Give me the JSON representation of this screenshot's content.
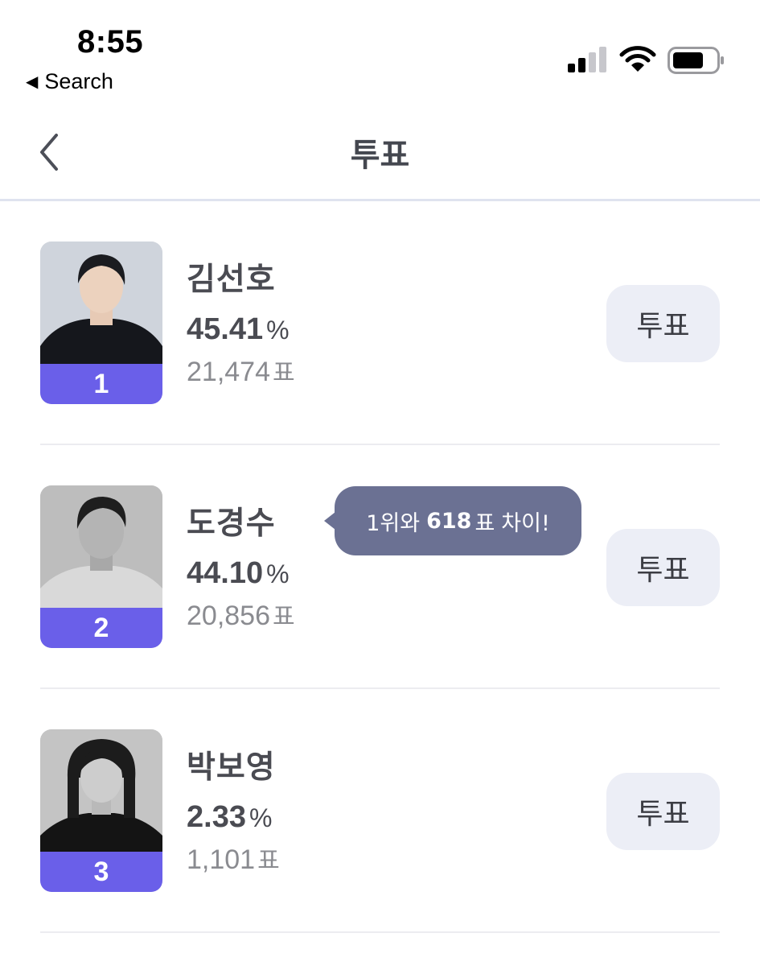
{
  "status_bar": {
    "time": "8:55",
    "back_label": "Search",
    "signal_icon": "cellular-signal-icon",
    "wifi_icon": "wifi-icon",
    "battery_icon": "battery-icon"
  },
  "nav": {
    "title": "투표",
    "back_icon": "chevron-left-icon"
  },
  "candidates": [
    {
      "rank": "1",
      "name": "김선호",
      "percent": "45.41",
      "percent_unit": "%",
      "votes": "21,474",
      "votes_unit": "표",
      "button_label": "투표"
    },
    {
      "rank": "2",
      "name": "도경수",
      "percent": "44.10",
      "percent_unit": "%",
      "votes": "20,856",
      "votes_unit": "표",
      "button_label": "투표"
    },
    {
      "rank": "3",
      "name": "박보영",
      "percent": "2.33",
      "percent_unit": "%",
      "votes": "1,101",
      "votes_unit": "표",
      "button_label": "투표"
    }
  ],
  "tooltip": {
    "prefix": "1위와",
    "diff": "618",
    "unit": "표",
    "suffix": "차이!"
  },
  "colors": {
    "rank_badge": "#6a5fe9",
    "tooltip_bg": "#6b7193",
    "vote_button_bg": "#eceef6",
    "divider": "#ececf0"
  }
}
